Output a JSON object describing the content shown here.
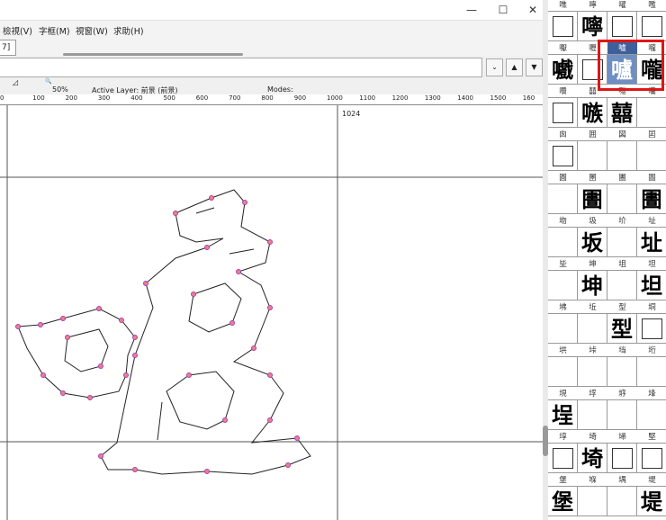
{
  "window": {
    "minimize_icon": "—",
    "maximize_icon": "☐",
    "close_icon": "✕"
  },
  "menu": {
    "view": "檢視(V)",
    "metrics": "字框(M)",
    "window": "視窗(W)",
    "help": "求助(H)"
  },
  "tab": {
    "label": "7]"
  },
  "address": {
    "value": ""
  },
  "toolbar": {
    "dropdown_icon": "⌄",
    "nav_up_icon": "▲",
    "nav_down_icon": "▼"
  },
  "info": {
    "tool_icon": "◿",
    "zoom_icon": "🔍",
    "zoom": "50%",
    "active_layer": "Active Layer: 前景 (前景)",
    "modes": "Modes:"
  },
  "ruler": {
    "ticks": [
      "0",
      "100",
      "200",
      "300",
      "400",
      "500",
      "600",
      "700",
      "800",
      "900",
      "1000",
      "1100",
      "1200",
      "1300",
      "1400",
      "1500",
      "160"
    ]
  },
  "canvas": {
    "width_label": "1024"
  },
  "glyph_grid": {
    "labels": [
      [
        "噍",
        "嚀",
        "嚁",
        "嚂"
      ],
      [
        "嚈",
        "嚦",
        "嚧",
        "嚨"
      ],
      [
        "囋",
        "囍",
        "囎",
        "囒"
      ],
      [
        "囪",
        "囲",
        "図",
        "囸"
      ],
      [
        "圓",
        "圛",
        "圕",
        "圗"
      ],
      [
        "圽",
        "圾",
        "圿",
        "址"
      ],
      [
        "坒",
        "坤",
        "坥",
        "坦"
      ],
      [
        "坲",
        "坵",
        "型",
        "垌"
      ],
      [
        "垬",
        "垰",
        "垱",
        "垳"
      ],
      [
        "垷",
        "垺",
        "垿",
        "埄"
      ],
      [
        "埻",
        "埼",
        "埽",
        "堅"
      ],
      [
        "堡",
        "堢",
        "堣",
        "堤"
      ]
    ],
    "glyphs": [
      [
        "",
        "嚀",
        "",
        ""
      ],
      [
        "嚱",
        "",
        "嚧",
        "嚨"
      ],
      [
        "",
        "嗾",
        "囍",
        ""
      ],
      [
        "",
        "",
        "",
        ""
      ],
      [
        "",
        "圕",
        "",
        "圕"
      ],
      [
        "",
        "坂",
        "",
        "址"
      ],
      [
        "",
        "坤",
        "",
        "坦"
      ],
      [
        "",
        "",
        "型",
        ""
      ],
      [
        "",
        "",
        "",
        ""
      ],
      [
        "埕",
        "",
        "",
        ""
      ],
      [
        "",
        "埼",
        "",
        ""
      ],
      [
        "堡",
        "",
        "",
        "堤"
      ]
    ],
    "empty_boxes": [
      [
        "r0c0",
        "r0c2",
        "r0c3"
      ],
      [
        "r1c1"
      ],
      [
        "r2c0"
      ],
      [
        "r3c0"
      ],
      [],
      [],
      [],
      [
        "r7c3"
      ],
      [],
      [],
      [
        "r10c0",
        "r10c2",
        "r10c3"
      ],
      []
    ],
    "selected": "嚧"
  }
}
